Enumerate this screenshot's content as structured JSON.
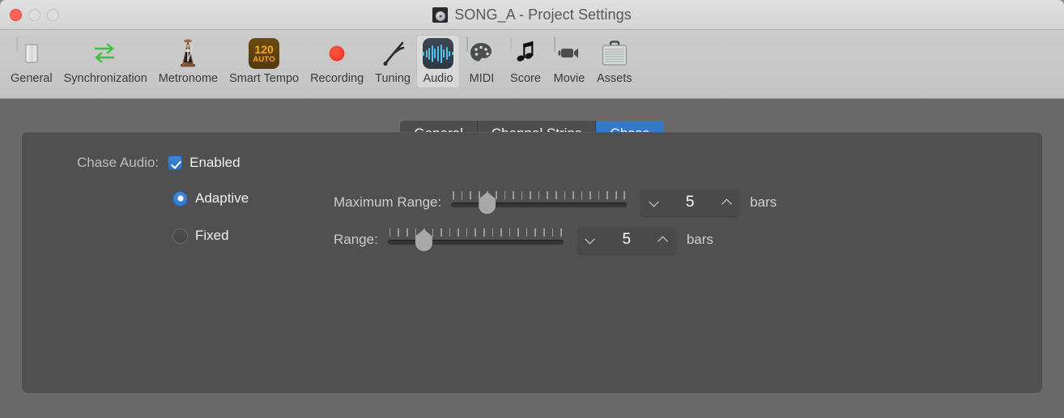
{
  "window": {
    "title": "SONG_A - Project Settings",
    "title_icon": "project-disc-icon",
    "traffic_lights": {
      "close": "close-button",
      "minimize": "minimize-button",
      "maximize": "maximize-button"
    }
  },
  "toolbar": {
    "items": [
      {
        "label": "General",
        "icon": "light-switch-icon",
        "selected": false
      },
      {
        "label": "Synchronization",
        "icon": "sync-arrows-icon",
        "selected": false
      },
      {
        "label": "Metronome",
        "icon": "metronome-icon",
        "selected": false
      },
      {
        "label": "Smart Tempo",
        "icon": "smart-tempo-icon",
        "selected": false,
        "badge_number": "120",
        "badge_mode": "AUTO"
      },
      {
        "label": "Recording",
        "icon": "record-circle-icon",
        "selected": false
      },
      {
        "label": "Tuning",
        "icon": "tuning-fork-icon",
        "selected": false
      },
      {
        "label": "Audio",
        "icon": "audio-waveform-icon",
        "selected": true
      },
      {
        "label": "MIDI",
        "icon": "midi-palette-icon",
        "selected": false
      },
      {
        "label": "Score",
        "icon": "music-note-icon",
        "selected": false
      },
      {
        "label": "Movie",
        "icon": "video-camera-icon",
        "selected": false
      },
      {
        "label": "Assets",
        "icon": "briefcase-icon",
        "selected": false
      }
    ]
  },
  "tabs": {
    "items": [
      {
        "label": "General",
        "active": false
      },
      {
        "label": "Channel Strips",
        "active": false
      },
      {
        "label": "Chase",
        "active": true
      }
    ],
    "active_color": "#3478c8"
  },
  "panel": {
    "chase_audio": {
      "label": "Chase Audio:",
      "enabled": {
        "label": "Enabled",
        "checked": true
      },
      "mode": {
        "adaptive": {
          "label": "Adaptive",
          "selected": true
        },
        "fixed": {
          "label": "Fixed",
          "selected": false
        }
      }
    },
    "maximum_range": {
      "label": "Maximum Range:",
      "slider": {
        "value": 5,
        "min": 1,
        "max": 21,
        "ticks": 21
      },
      "stepper_value": "5",
      "unit": "bars",
      "decrement_icon": "chevron-down-icon",
      "increment_icon": "chevron-up-icon"
    },
    "range": {
      "label": "Range:",
      "slider": {
        "value": 5,
        "min": 1,
        "max": 21,
        "ticks": 21
      },
      "stepper_value": "5",
      "unit": "bars",
      "decrement_icon": "chevron-down-icon",
      "increment_icon": "chevron-up-icon"
    }
  },
  "colors": {
    "accent_blue": "#3478c8",
    "control_blue": "#3f86d8",
    "panel_bg": "#505050",
    "content_bg": "#6a6a6a",
    "toolbar_bg": "#c8c8c8",
    "close_red": "#ff6158"
  }
}
